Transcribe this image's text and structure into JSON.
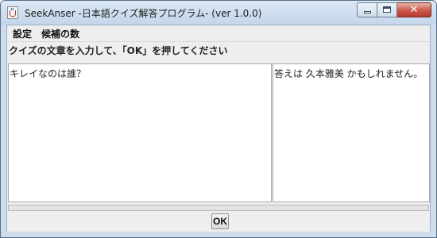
{
  "window": {
    "title": "SeekAnser -日本語クイズ解答プログラム- (ver 1.0.0)",
    "app_icon": "java-cup-icon",
    "controls": {
      "minimize_icon": "minimize-icon",
      "maximize_icon": "maximize-icon",
      "close_icon": "close-icon",
      "close_glyph": "✕"
    }
  },
  "menubar": {
    "items": [
      {
        "label": "設定"
      },
      {
        "label": "候補の数"
      }
    ]
  },
  "prompt": "クイズの文章を入力して、「OK」を押してください",
  "question": {
    "value": "キレイなのは誰？"
  },
  "answer": {
    "value": "答えは 久本雅美 かもしれません。"
  },
  "ok_button": {
    "label": "OK"
  },
  "colors": {
    "titlebar": "#c4d6ea",
    "client_bg": "#eeeeee",
    "close_button": "#c9574a"
  }
}
